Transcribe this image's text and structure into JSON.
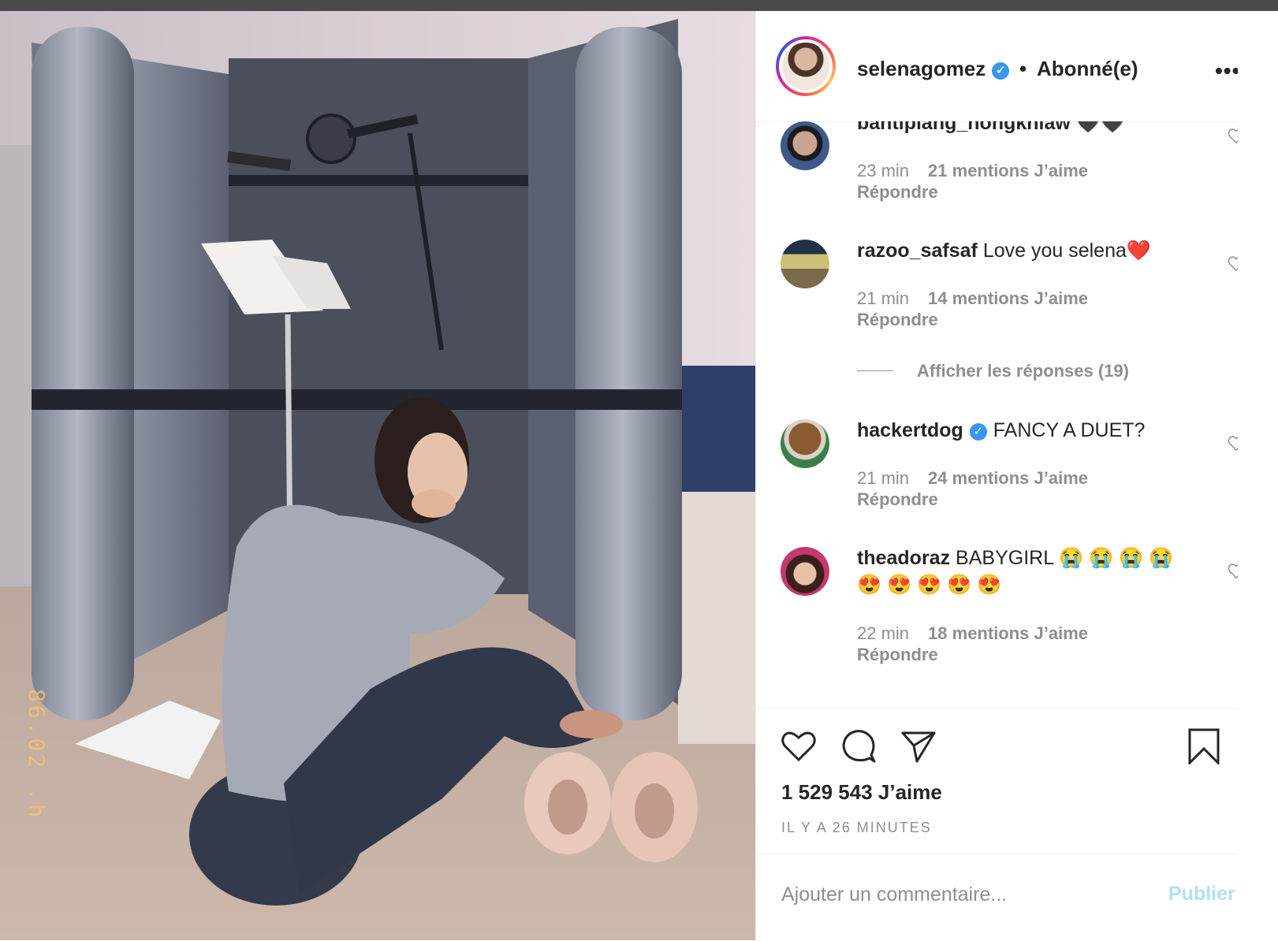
{
  "post": {
    "username": "selenagomez",
    "separator": "•",
    "follow_status": "Abonné(e)",
    "more_label": "•••",
    "photo_stamp": "86.02 .h",
    "likes": "1 529 543 J’aime",
    "time_ago": "IL Y A 26 MINUTES"
  },
  "comments": [
    {
      "user": "bantiplang_nongkhlaw",
      "text": "🖤🖤",
      "time": "23 min",
      "likes": "21 mentions J’aime",
      "reply": "Répondre"
    },
    {
      "user": "razoo_safsaf",
      "text": "Love you selena❤️",
      "time": "21 min",
      "likes": "14 mentions J’aime",
      "reply": "Répondre"
    },
    {
      "user": "hackertdog",
      "text": "FANCY A DUET?",
      "time": "21 min",
      "likes": "24 mentions J’aime",
      "reply": "Répondre"
    },
    {
      "user": "theadoraz",
      "text": "BABYGIRL 😭 😭 😭 😭",
      "text2": "😍 😍 😍 😍 😍",
      "time": "22 min",
      "likes": "18 mentions J’aime",
      "reply": "Répondre"
    }
  ],
  "view_replies": "Afficher les réponses (19)",
  "composer": {
    "placeholder": "Ajouter un commentaire...",
    "publish_label": "Publier"
  },
  "icons": {
    "verified": "verified-badge-icon",
    "like": "heart-icon",
    "comment": "comment-bubble-icon",
    "share": "paper-plane-icon",
    "save": "bookmark-icon"
  },
  "colors": {
    "verified_blue": "#3897f0",
    "muted_text": "#8e8e8e",
    "publish_disabled": "#b2dffc"
  }
}
